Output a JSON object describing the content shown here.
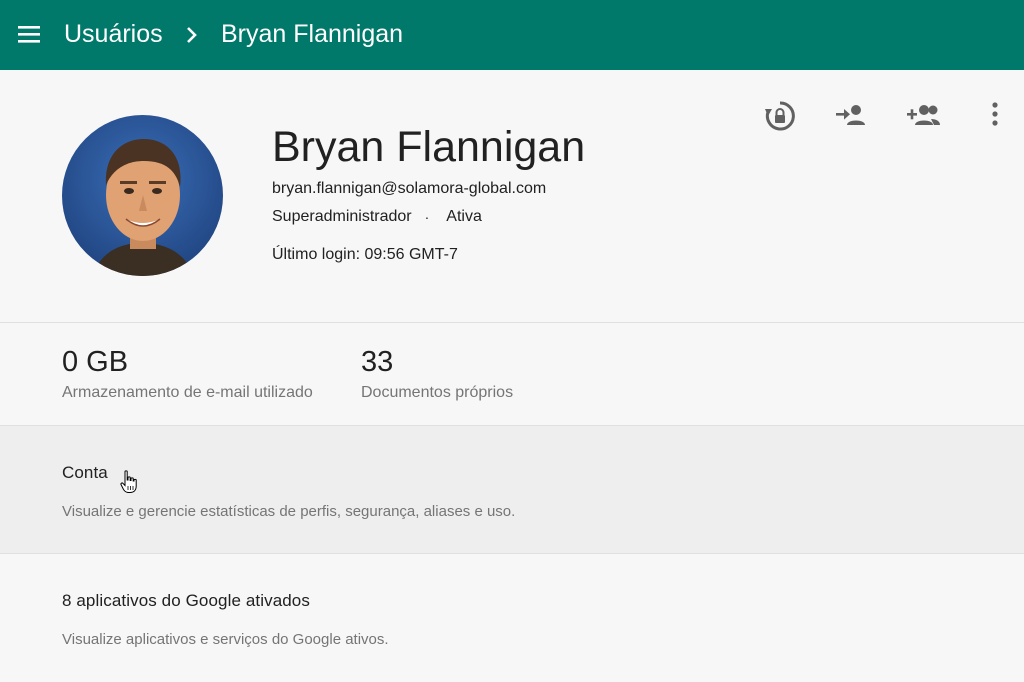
{
  "header": {
    "breadcrumb_root": "Usuários",
    "breadcrumb_current": "Bryan Flannigan",
    "bar_color": "#00796b"
  },
  "profile": {
    "name": "Bryan Flannigan",
    "email": "bryan.flannigan@solamora-global.com",
    "role": "Superadministrador",
    "separator": "·",
    "status": "Ativa",
    "last_login": "Último login: 09:56 GMT-7",
    "actions": [
      "reset-password-icon",
      "add-to-group-icon",
      "add-to-groups-icon",
      "more-options-icon"
    ]
  },
  "stats": [
    {
      "value": "0 GB",
      "label": "Armazenamento de e-mail utilizado"
    },
    {
      "value": "33",
      "label": "Documentos próprios"
    }
  ],
  "cards": {
    "account": {
      "title": "Conta",
      "description": "Visualize e gerencie estatísticas de perfis, segurança, aliases e uso."
    },
    "apps": {
      "title": "8 aplicativos do Google ativados",
      "description": "Visualize aplicativos e serviços do Google ativos."
    }
  }
}
